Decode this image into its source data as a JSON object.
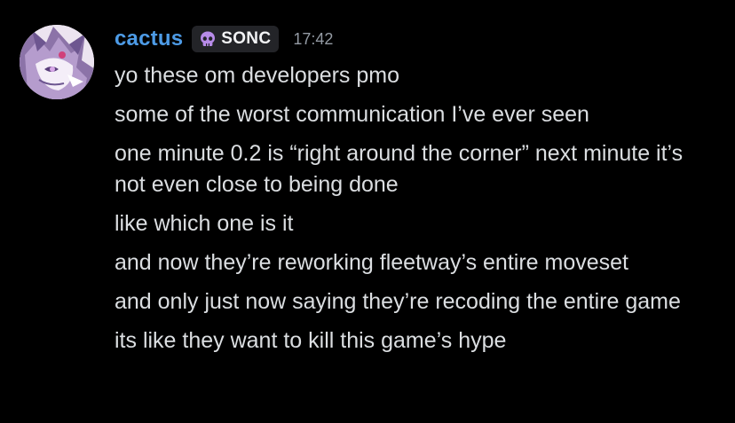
{
  "message": {
    "author": "cactus",
    "tag": {
      "label": "SONC",
      "icon": "skull-icon",
      "icon_color": "#b78be8"
    },
    "timestamp": "17:42",
    "username_color": "#4d9be6",
    "lines": [
      "yo these om developers pmo",
      "some of the worst communication I’ve ever seen",
      "one minute 0.2 is “right around the corner” next minute it’s not even close to being done",
      "like which one is it",
      "and now they’re reworking fleetway’s entire moveset",
      "and only just now saying they’re recoding the entire game",
      "its like they want to kill this game’s hype"
    ]
  }
}
